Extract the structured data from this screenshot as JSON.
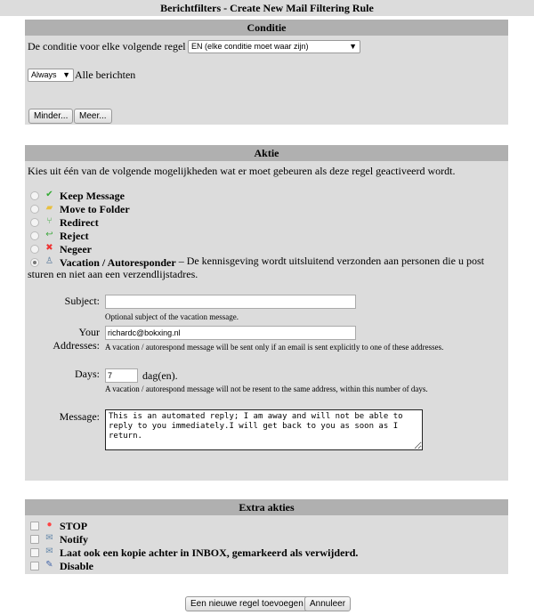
{
  "title": "Berichtfilters - Create New Mail Filtering Rule",
  "conditie": {
    "header": "Conditie",
    "label": "De conditie voor elke volgende regel is:",
    "select": "EN (elke conditie moet waar zijn)",
    "always_select": "Always",
    "always_text": "Alle berichten",
    "less": "Minder...",
    "more": "Meer..."
  },
  "aktie": {
    "header": "Aktie",
    "intro": "Kies uit één van de volgende mogelijkheden wat er moet gebeuren als deze regel geactiveerd wordt.",
    "options": [
      {
        "label": "Keep Message",
        "icon": "check-icon"
      },
      {
        "label": "Move to Folder",
        "icon": "folder-icon"
      },
      {
        "label": "Redirect",
        "icon": "redirect-icon"
      },
      {
        "label": "Reject",
        "icon": "reject-icon"
      },
      {
        "label": "Negeer",
        "icon": "x-icon"
      },
      {
        "label": "Vacation / Autoresponder",
        "icon": "vacation-icon",
        "selected": true
      }
    ],
    "vacation_desc": "– De kennisgeving wordt uitsluitend verzonden aan personen die u post sturen en niet aan een verzendlijstadres.",
    "subject_label": "Subject:",
    "subject_value": "",
    "subject_help": "Optional subject of the vacation message.",
    "addr_label1": "Your",
    "addr_label2": "Addresses:",
    "addr_value": "richardc@bokxing.nl",
    "addr_help": "A vacation / autorespond message will be sent only if an email is sent explicitly to one of these addresses.",
    "days_label": "Days:",
    "days_value": "7",
    "days_unit": "dag(en).",
    "days_help": "A vacation / autorespond message will not be resent to the same address, within this number of days.",
    "message_label": "Message:",
    "message_value": "This is an automated reply; I am away and will not be able to reply to you immediately.I will get back to you as soon as I return."
  },
  "extra": {
    "header": "Extra akties",
    "options": [
      {
        "label": "STOP",
        "icon": "stop-icon"
      },
      {
        "label": "Notify",
        "icon": "envelope-icon"
      },
      {
        "label": "Laat ook een kopie achter in INBOX, gemarkeerd als verwijderd.",
        "icon": "envelope-copy-icon"
      },
      {
        "label": "Disable",
        "icon": "disable-icon"
      }
    ]
  },
  "buttons": {
    "add": "Een nieuwe regel toevoegen",
    "cancel": "Annuleer"
  }
}
